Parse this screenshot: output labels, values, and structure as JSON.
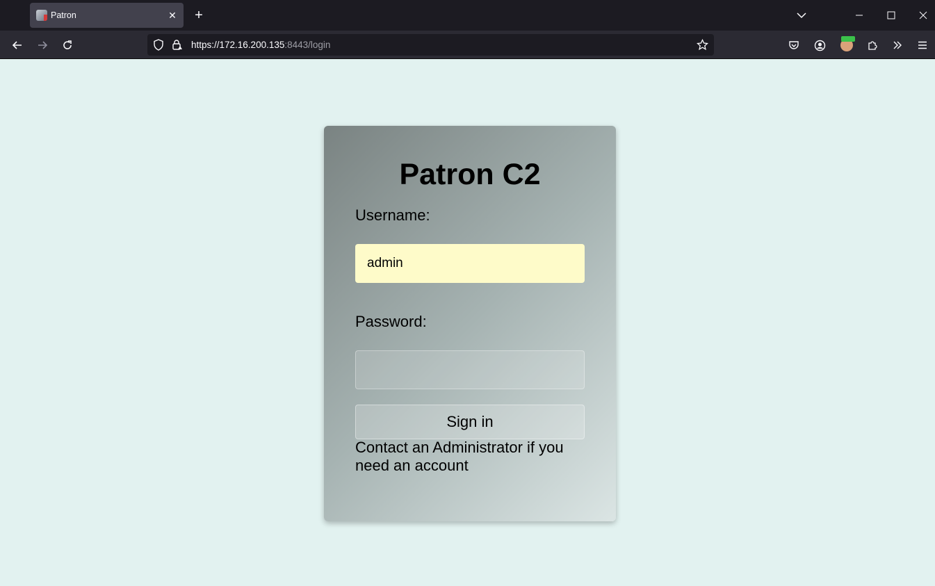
{
  "browser": {
    "tab_title": "Patron",
    "url_host": "https://172.16.200.135",
    "url_path": ":8443/login"
  },
  "page": {
    "heading": "Patron C2",
    "username_label": "Username:",
    "username_value": "admin",
    "password_label": "Password:",
    "password_value": "",
    "signin_label": "Sign in",
    "contact_text": "Contact an Administrator if you need an account"
  },
  "icons": [
    "back-icon",
    "forward-icon",
    "reload-icon",
    "shield-icon",
    "lock-icon",
    "star-icon",
    "pocket-icon",
    "account-icon",
    "extension-icon",
    "overflow-icon",
    "menu-icon",
    "close-icon",
    "new-tab-icon",
    "tab-list-icon",
    "minimize-icon",
    "maximize-icon",
    "window-close-icon"
  ],
  "colors": {
    "page_bg": "#e2f2f0",
    "username_field_bg": "#fefbc9"
  }
}
